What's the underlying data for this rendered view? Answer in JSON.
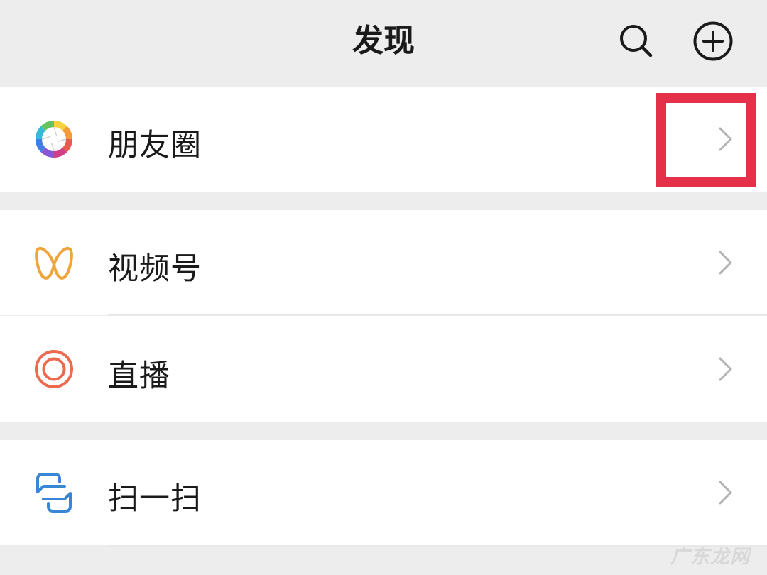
{
  "header": {
    "title": "发现",
    "search_icon": "search-icon",
    "add_icon": "plus-circle-icon"
  },
  "menu": [
    {
      "label": "朋友圈",
      "icon": "moments-aperture-icon"
    },
    {
      "label": "视频号",
      "icon": "channels-icon"
    },
    {
      "label": "直播",
      "icon": "live-icon"
    },
    {
      "label": "扫一扫",
      "icon": "scan-icon"
    }
  ],
  "watermark": "广东龙网",
  "colors": {
    "background": "#ededed",
    "row": "#ffffff",
    "highlight": "#e5304a",
    "channels": "#f0a53c",
    "live": "#ec6a4f",
    "scan": "#3a86d6",
    "chevron": "#b3b3b3"
  }
}
